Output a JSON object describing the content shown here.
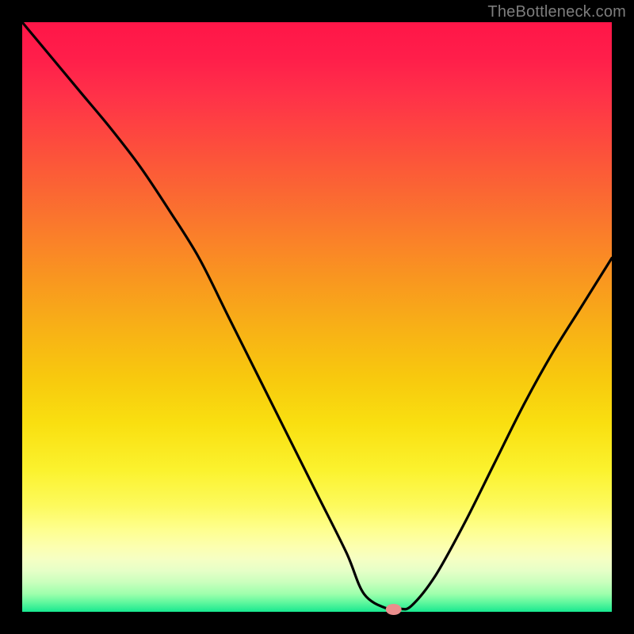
{
  "attribution": "TheBottleneck.com",
  "chart_data": {
    "type": "line",
    "title": "",
    "xlabel": "",
    "ylabel": "",
    "xlim": [
      0,
      100
    ],
    "ylim": [
      0,
      100
    ],
    "grid": false,
    "legend": false,
    "background": "vertical-gradient red→orange→yellow→green",
    "series": [
      {
        "name": "bottleneck-curve",
        "color": "#000000",
        "x": [
          0,
          5,
          10,
          15,
          20,
          25,
          30,
          35,
          40,
          45,
          50,
          55,
          58,
          62,
          64,
          66,
          70,
          75,
          80,
          85,
          90,
          95,
          100
        ],
        "y": [
          100,
          94,
          88,
          82,
          75.5,
          68,
          60,
          50,
          40,
          30,
          20,
          10,
          3,
          0.5,
          0.5,
          1,
          6,
          15,
          25,
          35,
          44,
          52,
          60
        ]
      }
    ],
    "marker": {
      "name": "optimum-marker",
      "x": 63,
      "y": 0,
      "color": "#ea8d8c"
    }
  }
}
